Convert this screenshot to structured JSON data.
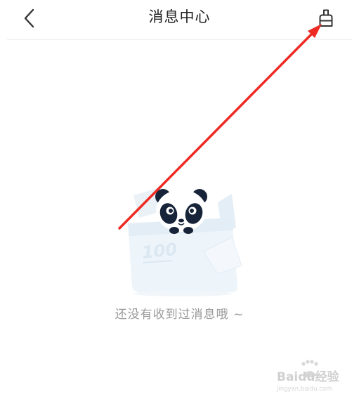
{
  "header": {
    "title": "消息中心",
    "back_icon": "chevron-left-icon",
    "action_icon": "broom-icon"
  },
  "empty_state": {
    "message": "还没有收到过消息哦 ~",
    "illustration_badge": "100"
  },
  "watermark": {
    "logo_text": "Baidu经验",
    "domain_text": "jingyan.baidu.com"
  },
  "colors": {
    "title": "#222222",
    "empty_text": "#9a9a9a",
    "annotation_arrow": "#ee2a24",
    "illustration_box": "#eaf2f8",
    "panda_dark": "#162338"
  }
}
